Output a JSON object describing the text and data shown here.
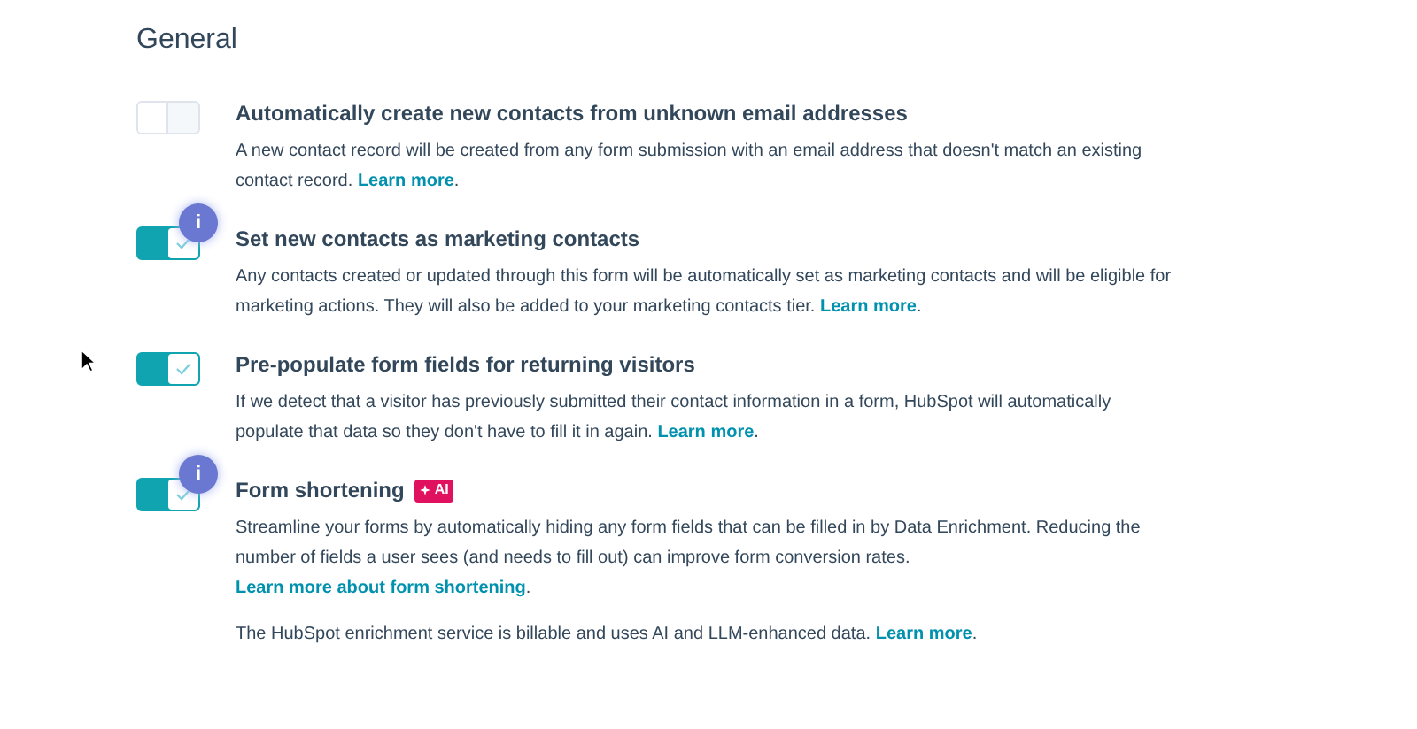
{
  "section_title": "General",
  "settings": [
    {
      "title": "Automatically create new contacts from unknown email addresses",
      "on": false,
      "info_marker": false,
      "paragraphs": [
        {
          "text": "A new contact record will be created from any form submission with an email address that doesn't match an existing contact record.",
          "link": "Learn more",
          "after": "."
        }
      ]
    },
    {
      "title": "Set new contacts as marketing contacts",
      "on": true,
      "info_marker": true,
      "info_text": "i",
      "paragraphs": [
        {
          "text": "Any contacts created or updated through this form will be automatically set as marketing contacts and will be eligible for marketing actions. They will also be added to your marketing contacts tier.",
          "link": "Learn more",
          "after": "."
        }
      ]
    },
    {
      "title": "Pre-populate form fields for returning visitors",
      "on": true,
      "info_marker": false,
      "paragraphs": [
        {
          "text": "If we detect that a visitor has previously submitted their contact information in a form, HubSpot will automatically populate that data so they don't have to fill it in again.",
          "link": "Learn more",
          "after": "."
        }
      ]
    },
    {
      "title": "Form shortening",
      "badge": "AI",
      "on": true,
      "info_marker": true,
      "info_text": "i",
      "paragraphs": [
        {
          "text": "Streamline your forms by automatically hiding any form fields that can be filled in by Data Enrichment. Reducing the number of fields a user sees (and needs to fill out) can improve form conversion rates.",
          "link": "Learn more about form shortening",
          "after": "."
        },
        {
          "text": "The HubSpot enrichment service is billable and uses AI and LLM-enhanced data.",
          "link": "Learn more",
          "after": "."
        }
      ]
    }
  ]
}
